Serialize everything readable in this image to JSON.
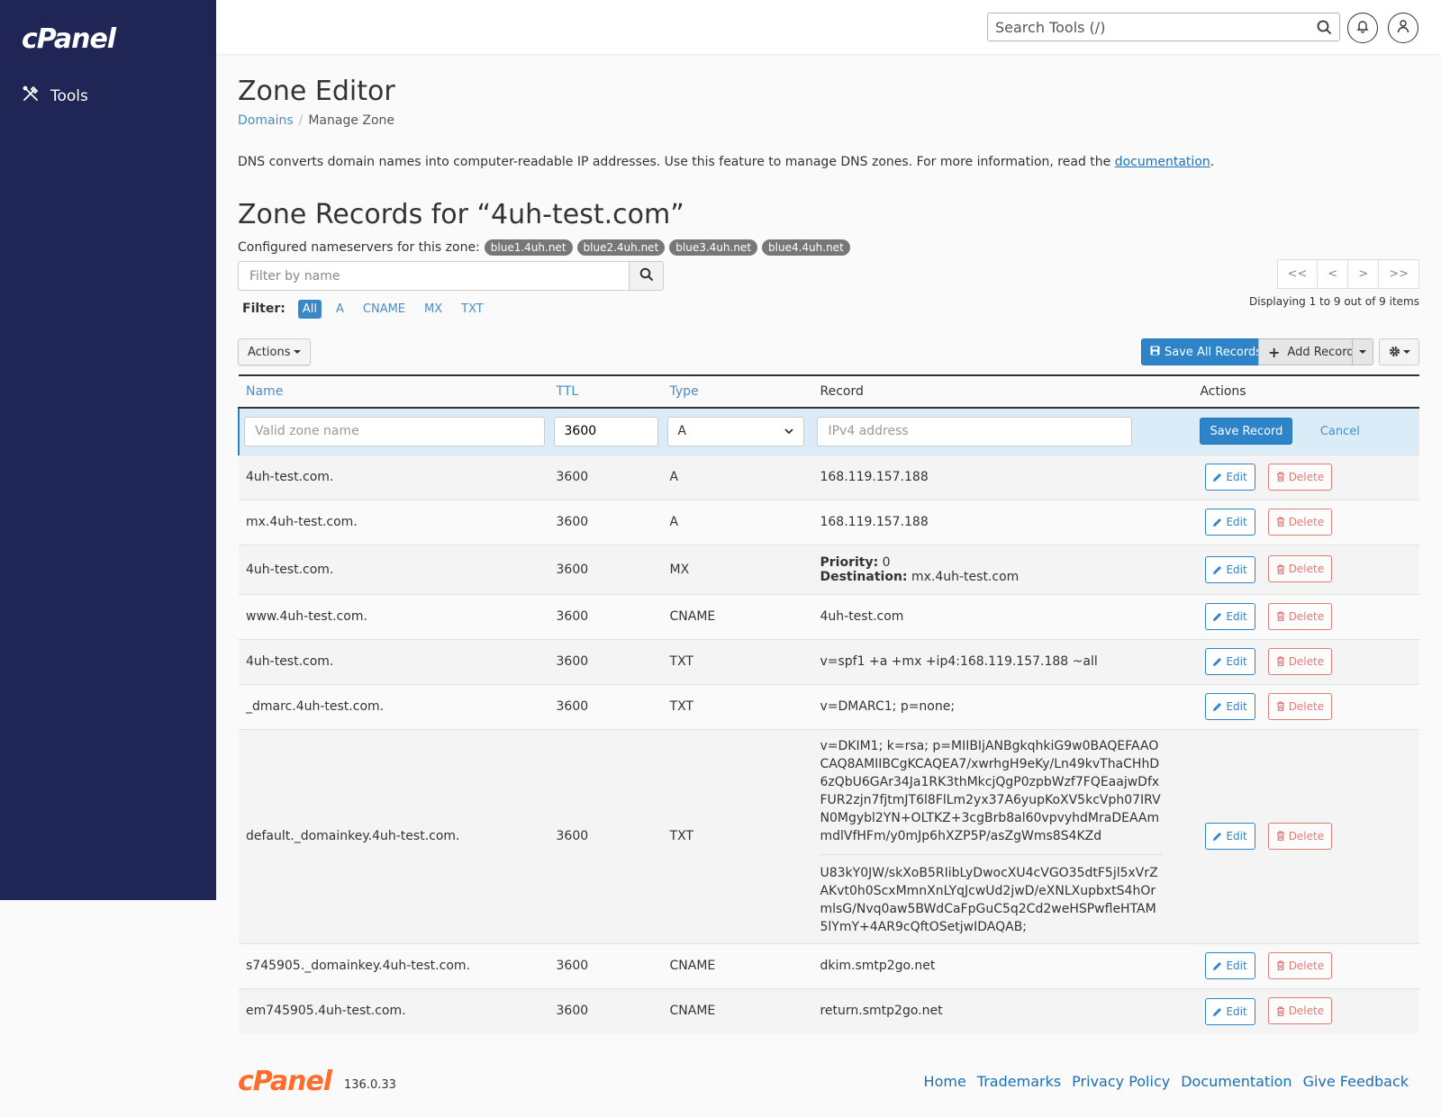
{
  "sidebar": {
    "logo": "cPanel",
    "tools_label": "Tools"
  },
  "topbar": {
    "search_placeholder": "Search Tools (/)"
  },
  "page": {
    "title": "Zone Editor",
    "breadcrumb": {
      "link": "Domains",
      "current": "Manage Zone"
    },
    "intro_text": "DNS converts domain names into computer-readable IP addresses. Use this feature to manage DNS zones. For more information, read the ",
    "intro_link": "documentation",
    "intro_end": "."
  },
  "zone": {
    "title": "Zone Records for “4uh-test.com”",
    "nameservers_label": "Configured nameservers for this zone:",
    "nameservers": [
      "blue1.4uh.net",
      "blue2.4uh.net",
      "blue3.4uh.net",
      "blue4.4uh.net"
    ]
  },
  "filter": {
    "placeholder": "Filter by name",
    "label": "Filter:",
    "types": [
      "All",
      "A",
      "CNAME",
      "MX",
      "TXT"
    ],
    "active": "All"
  },
  "pagination": {
    "buttons": [
      "<<",
      "<",
      ">",
      ">>"
    ],
    "displaying": "Displaying 1 to 9 out of 9 items"
  },
  "toolbar": {
    "actions_label": "Actions",
    "save_all_label": "Save All Records",
    "add_record_label": "Add Record"
  },
  "table": {
    "headers": {
      "name": "Name",
      "ttl": "TTL",
      "type": "Type",
      "record": "Record",
      "actions": "Actions"
    },
    "new_row": {
      "name_placeholder": "Valid zone name",
      "ttl_value": "3600",
      "type_value": "A",
      "record_placeholder": "IPv4 address",
      "save_label": "Save Record",
      "cancel_label": "Cancel"
    },
    "edit_label": "Edit",
    "delete_label": "Delete",
    "rows": [
      {
        "name": "4uh-test.com.",
        "ttl": "3600",
        "type": "A",
        "record": "168.119.157.188"
      },
      {
        "name": "mx.4uh-test.com.",
        "ttl": "3600",
        "type": "A",
        "record": "168.119.157.188"
      },
      {
        "name": "4uh-test.com.",
        "ttl": "3600",
        "type": "MX",
        "priority_label": "Priority:",
        "priority": "0",
        "destination_label": "Destination:",
        "destination": "mx.4uh-test.com"
      },
      {
        "name": "www.4uh-test.com.",
        "ttl": "3600",
        "type": "CNAME",
        "record": "4uh-test.com"
      },
      {
        "name": "4uh-test.com.",
        "ttl": "3600",
        "type": "TXT",
        "record": "v=spf1 +a +mx +ip4:168.119.157.188 ~all"
      },
      {
        "name": "_dmarc.4uh-test.com.",
        "ttl": "3600",
        "type": "TXT",
        "record": "v=DMARC1; p=none;"
      },
      {
        "name": "default._domainkey.4uh-test.com.",
        "ttl": "3600",
        "type": "TXT",
        "record_part1": "v=DKIM1; k=rsa; p=MIIBIjANBgkqhkiG9w0BAQEFAAOCAQ8AMIIBCgKCAQEA7/xwrhgH9eKy/Ln49kvThaCHhD6zQbU6GAr34Ja1RK3thMkcjQgP0zpbWzf7FQEaajwDfxFUR2zjn7fjtmJT6l8FlLm2yx37A6yupKoXV5kcVph07IRVN0Mgybl2YN+OLTKZ+3cgBrb8al60vpvyhdMraDEAAmmdlVfHFm/y0mJp6hXZP5P/asZgWms8S4KZd",
        "record_part2": "U83kY0JW/skXoB5RIibLyDwocXU4cVGO35dtF5jl5xVrZAKvt0h0ScxMmnXnLYqJcwUd2jwD/eXNLXupbxtS4hOrmlsG/Nvq0aw5BWdCaFpGuC5q2Cd2weHSPwfleHTAM5lYmY+4AR9cQftOSetjwIDAQAB;"
      },
      {
        "name": "s745905._domainkey.4uh-test.com.",
        "ttl": "3600",
        "type": "CNAME",
        "record": "dkim.smtp2go.net"
      },
      {
        "name": "em745905.4uh-test.com.",
        "ttl": "3600",
        "type": "CNAME",
        "record": "return.smtp2go.net"
      }
    ]
  },
  "footer": {
    "logo": "cPanel",
    "version": "136.0.33",
    "links": [
      "Home",
      "Trademarks",
      "Privacy Policy",
      "Documentation",
      "Give Feedback"
    ]
  },
  "colors": {
    "sidebar": "#1f2555",
    "primary": "#2e84c9",
    "link": "#4a8ec7",
    "danger": "#d9534f",
    "footer_logo": "#ff6c2c"
  }
}
